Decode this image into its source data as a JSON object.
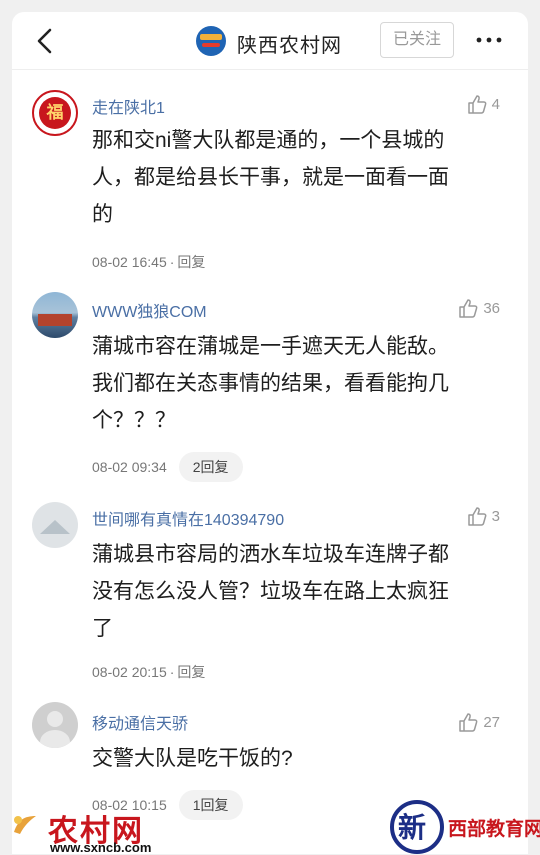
{
  "header": {
    "site_name": "陕西农村网",
    "follow_label": "已关注"
  },
  "comments": [
    {
      "username": "走在陕北1",
      "likes": "4",
      "text_lines": [
        "那和交ni警大队都是通的，一个县城的",
        "人，都是给县长干事，就是一面看一面",
        "的"
      ],
      "time": "08-02 16:45",
      "reply": "回复"
    },
    {
      "username": "WWW独狼COM",
      "likes": "36",
      "text_lines": [
        "蒲城市容在蒲城是一手遮天无人能敌。",
        "我们都在关态事情的结果，看看能拘几",
        "个？？？"
      ],
      "time": "08-02 09:34",
      "reply": "2回复"
    },
    {
      "username": "世间哪有真情在140394790",
      "likes": "3",
      "text_lines": [
        "蒲城县市容局的洒水车垃圾车连牌子都",
        "没有怎么没人管？垃圾车在路上太疯狂",
        "了"
      ],
      "time": "08-02 20:15",
      "reply": "回复"
    },
    {
      "username": "移动通信天骄",
      "likes": "27",
      "text_lines": [
        "交警大队是吃干饭的?"
      ],
      "time": "08-02 10:15",
      "reply": "1回复"
    }
  ],
  "watermark": {
    "left_brand": "农村网",
    "left_url": "www.sxncb.com",
    "right_mark": "新",
    "right_brand": "西部教育网"
  },
  "icons": {
    "back": "chevron-left-icon",
    "more": "more-dots-icon",
    "like": "thumbs-up-icon"
  },
  "colors": {
    "username": "#4a6fa5",
    "watermark_red": "#c8161d",
    "watermark_blue": "#1c2e86"
  }
}
